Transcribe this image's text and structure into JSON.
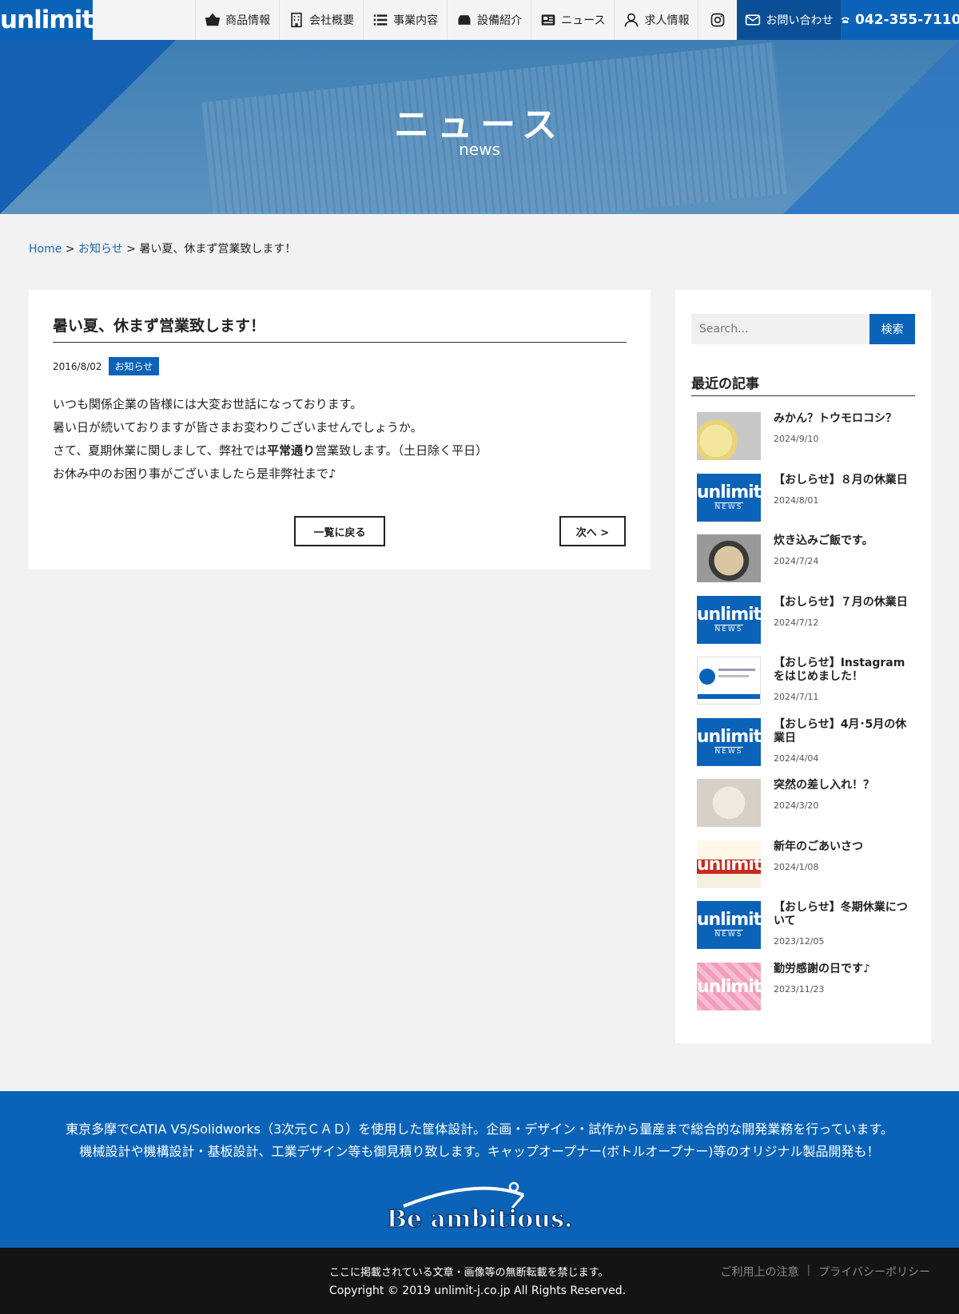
{
  "header": {
    "logo": "unlimit",
    "nav": [
      {
        "label": "商品情報",
        "icon": "basket-icon"
      },
      {
        "label": "会社概要",
        "icon": "building-icon"
      },
      {
        "label": "事業内容",
        "icon": "list-icon"
      },
      {
        "label": "設備紹介",
        "icon": "machine-icon"
      },
      {
        "label": "ニュース",
        "icon": "newspaper-icon"
      },
      {
        "label": "求人情報",
        "icon": "user-icon"
      }
    ],
    "contact_label": "お問い合わせ",
    "phone": "042-355-7110"
  },
  "hero": {
    "title": "ニュース",
    "subtitle": "news"
  },
  "breadcrumb": {
    "home": "Home",
    "sep": ">",
    "category": "お知らせ",
    "current": "暑い夏、休まず営業致します！"
  },
  "article": {
    "title": "暑い夏、休まず営業致します！",
    "date": "2016/8/02",
    "category": "お知らせ",
    "line1": "いつも関係企業の皆様には大変お世話になっております。",
    "line2": "暑い日が続いておりますが皆さまお変わりございませんでしょうか。",
    "line3_pre": "さて、夏期休業に関しまして、弊社では",
    "line3_bold": "平常通り",
    "line3_post": "営業致します。（土日除く平日）",
    "line4": "お休み中のお困り事がございましたら是非弊社まで♪",
    "back_label": "一覧に戻る",
    "next_label": "次へ >"
  },
  "sidebar": {
    "search_placeholder": "Search...",
    "search_button": "検索",
    "recent_title": "最近の記事",
    "recent": [
      {
        "title": "みかん？トウモロコシ？",
        "date": "2024/9/10"
      },
      {
        "title": "【おしらせ】８月の休業日",
        "date": "2024/8/01"
      },
      {
        "title": "炊き込みご飯です。",
        "date": "2024/7/24"
      },
      {
        "title": "【おしらせ】７月の休業日",
        "date": "2024/7/12"
      },
      {
        "title": "【おしらせ】Instagramをはじめました！",
        "date": "2024/7/11"
      },
      {
        "title": "【おしらせ】4月･5月の休業日",
        "date": "2024/4/04"
      },
      {
        "title": "突然の差し入れ！？",
        "date": "2024/3/20"
      },
      {
        "title": "新年のごあいさつ",
        "date": "2024/1/08"
      },
      {
        "title": "【おしらせ】冬期休業について",
        "date": "2023/12/05"
      },
      {
        "title": "勤労感謝の日です♪",
        "date": "2023/11/23"
      }
    ],
    "thumb_logo_text": "unlimit",
    "thumb_news_text": "NEWS"
  },
  "footer": {
    "line1": "東京多摩でCATIA V5/Solidworks（3次元ＣＡＤ）を使用した筐体設計。企画・デザイン・試作から量産まで総合的な開発業務を行っています。",
    "line2": "機械設計や機構設計・基板設計、工業デザイン等も御見積り致します。キャップオープナー(ボトルオープナー)等のオリジナル製品開発も！",
    "logo_text": "Be ambitious.",
    "notice": "ここに掲載されている文章・画像等の無断転載を禁じます。",
    "copyright": "Copyright © 2019 unlimit-j.co.jp All Rights Reserved.",
    "link_terms": "ご利用上の注意",
    "link_privacy": "プライバシーポリシー"
  }
}
